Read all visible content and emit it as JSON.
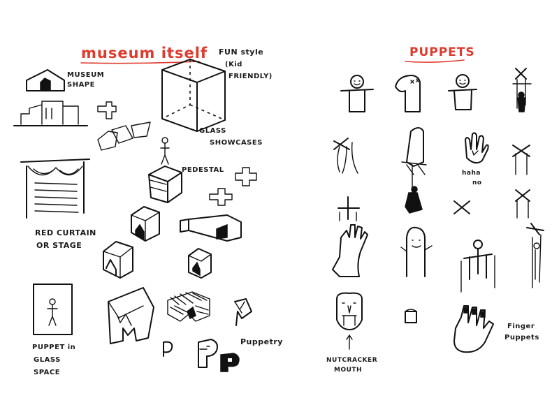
{
  "sections": {
    "museum": {
      "heading": "museum itself",
      "accent_color": "#e03a2e",
      "labels": {
        "museum_shape_1": "MUSEUM",
        "museum_shape_2": "SHAPE",
        "funstyle_1": "FUN style",
        "funstyle_2": "(Kid",
        "funstyle_3": "FRIENDLY)",
        "glass_1": "GLASS",
        "glass_2": "SHOWCASES",
        "pedestal": "PEDESTAL",
        "curtain_1": "RED CURTAIN",
        "curtain_2": "OR STAGE",
        "puppet_glass_1": "PUPPET in",
        "puppet_glass_2": "GLASS",
        "puppet_glass_3": "SPACE",
        "puppetry": "Puppetry"
      }
    },
    "puppets": {
      "heading": "PUPPETS",
      "accent_color": "#e03a2e",
      "labels": {
        "haha_1": "haha",
        "haha_2": "no",
        "nutcracker_1": "NUTCRACKER",
        "nutcracker_2": "MOUTH",
        "finger_1": "Finger",
        "finger_2": "Puppets"
      }
    }
  }
}
